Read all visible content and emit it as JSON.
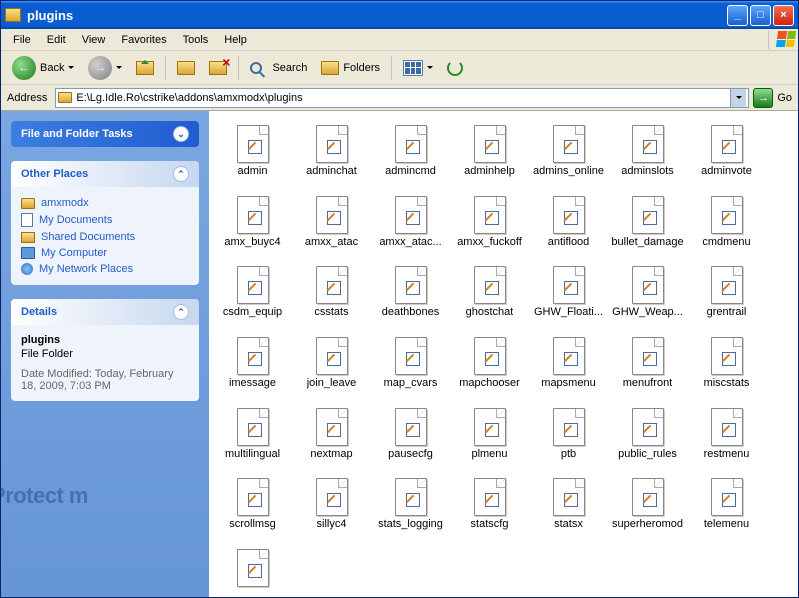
{
  "window": {
    "title": "plugins"
  },
  "menu": {
    "file": "File",
    "edit": "Edit",
    "view": "View",
    "favorites": "Favorites",
    "tools": "Tools",
    "help": "Help"
  },
  "toolbar": {
    "back": "Back",
    "search": "Search",
    "folders": "Folders"
  },
  "address": {
    "label": "Address",
    "value": "E:\\Lg.Idle.Ro\\cstrike\\addons\\amxmodx\\plugins",
    "go": "Go"
  },
  "sidebar": {
    "tasks_title": "File and Folder Tasks",
    "other_title": "Other Places",
    "other": [
      {
        "label": "amxmodx",
        "ico": "ico-fold"
      },
      {
        "label": "My Documents",
        "ico": "ico-mydoc"
      },
      {
        "label": "Shared Documents",
        "ico": "ico-shared"
      },
      {
        "label": "My Computer",
        "ico": "ico-mycomp"
      },
      {
        "label": "My Network Places",
        "ico": "ico-netpl"
      }
    ],
    "details_title": "Details",
    "details": {
      "name": "plugins",
      "type": "File Folder",
      "modified": "Date Modified: Today, February 18, 2009, 7:03 PM"
    }
  },
  "files": [
    "admin",
    "adminchat",
    "admincmd",
    "adminhelp",
    "admins_online",
    "adminslots",
    "adminvote",
    "amx_buyc4",
    "amxx_atac",
    "amxx_atac...",
    "amxx_fuckoff",
    "antiflood",
    "bullet_damage",
    "cmdmenu",
    "csdm_equip",
    "csstats",
    "deathbones",
    "ghostchat",
    "GHW_Floati...",
    "GHW_Weap...",
    "grentrail",
    "imessage",
    "join_leave",
    "map_cvars",
    "mapchooser",
    "mapsmenu",
    "menufront",
    "miscstats",
    "multilingual",
    "nextmap",
    "pausecfg",
    "plmenu",
    "ptb",
    "public_rules",
    "restmenu",
    "scrollmsg",
    "sillyc4",
    "stats_logging",
    "statscfg",
    "statsx",
    "superheromod",
    "telemenu",
    ""
  ],
  "watermark": "Protect m"
}
